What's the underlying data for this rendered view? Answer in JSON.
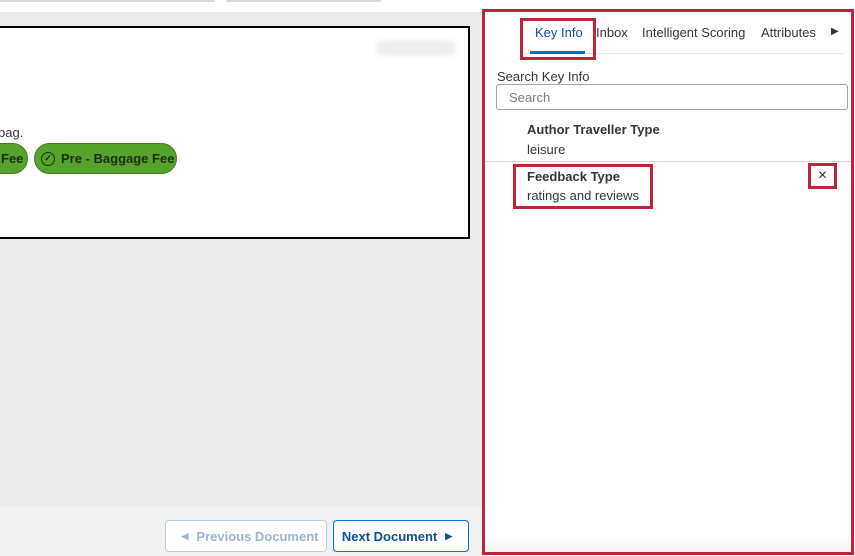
{
  "document": {
    "body_text": "bag.",
    "tags": [
      {
        "label": "Fee"
      },
      {
        "label": "Pre - Baggage Fee"
      }
    ]
  },
  "navigation": {
    "previous_label": "Previous Document",
    "next_label": "Next Document"
  },
  "panel": {
    "tabs": [
      {
        "label": "Key Info",
        "active": true
      },
      {
        "label": "Inbox"
      },
      {
        "label": "Intelligent Scoring"
      },
      {
        "label": "Attributes"
      }
    ],
    "search": {
      "label": "Search Key Info",
      "placeholder": "Search",
      "value": ""
    },
    "items": [
      {
        "title": "Author Traveller Type",
        "value": "leisure"
      },
      {
        "title": "Feedback Type",
        "value": "ratings and reviews"
      }
    ]
  },
  "icons": {
    "check": "check-circle-icon",
    "prev_arrow": "caret-left-icon",
    "next_arrow": "caret-right-icon",
    "tab_overflow": "caret-right-icon",
    "remove": "close-icon"
  },
  "colors": {
    "tag_green": "#55a32a",
    "highlight_red": "#c0243a",
    "primary_blue": "#0a6ed1"
  }
}
